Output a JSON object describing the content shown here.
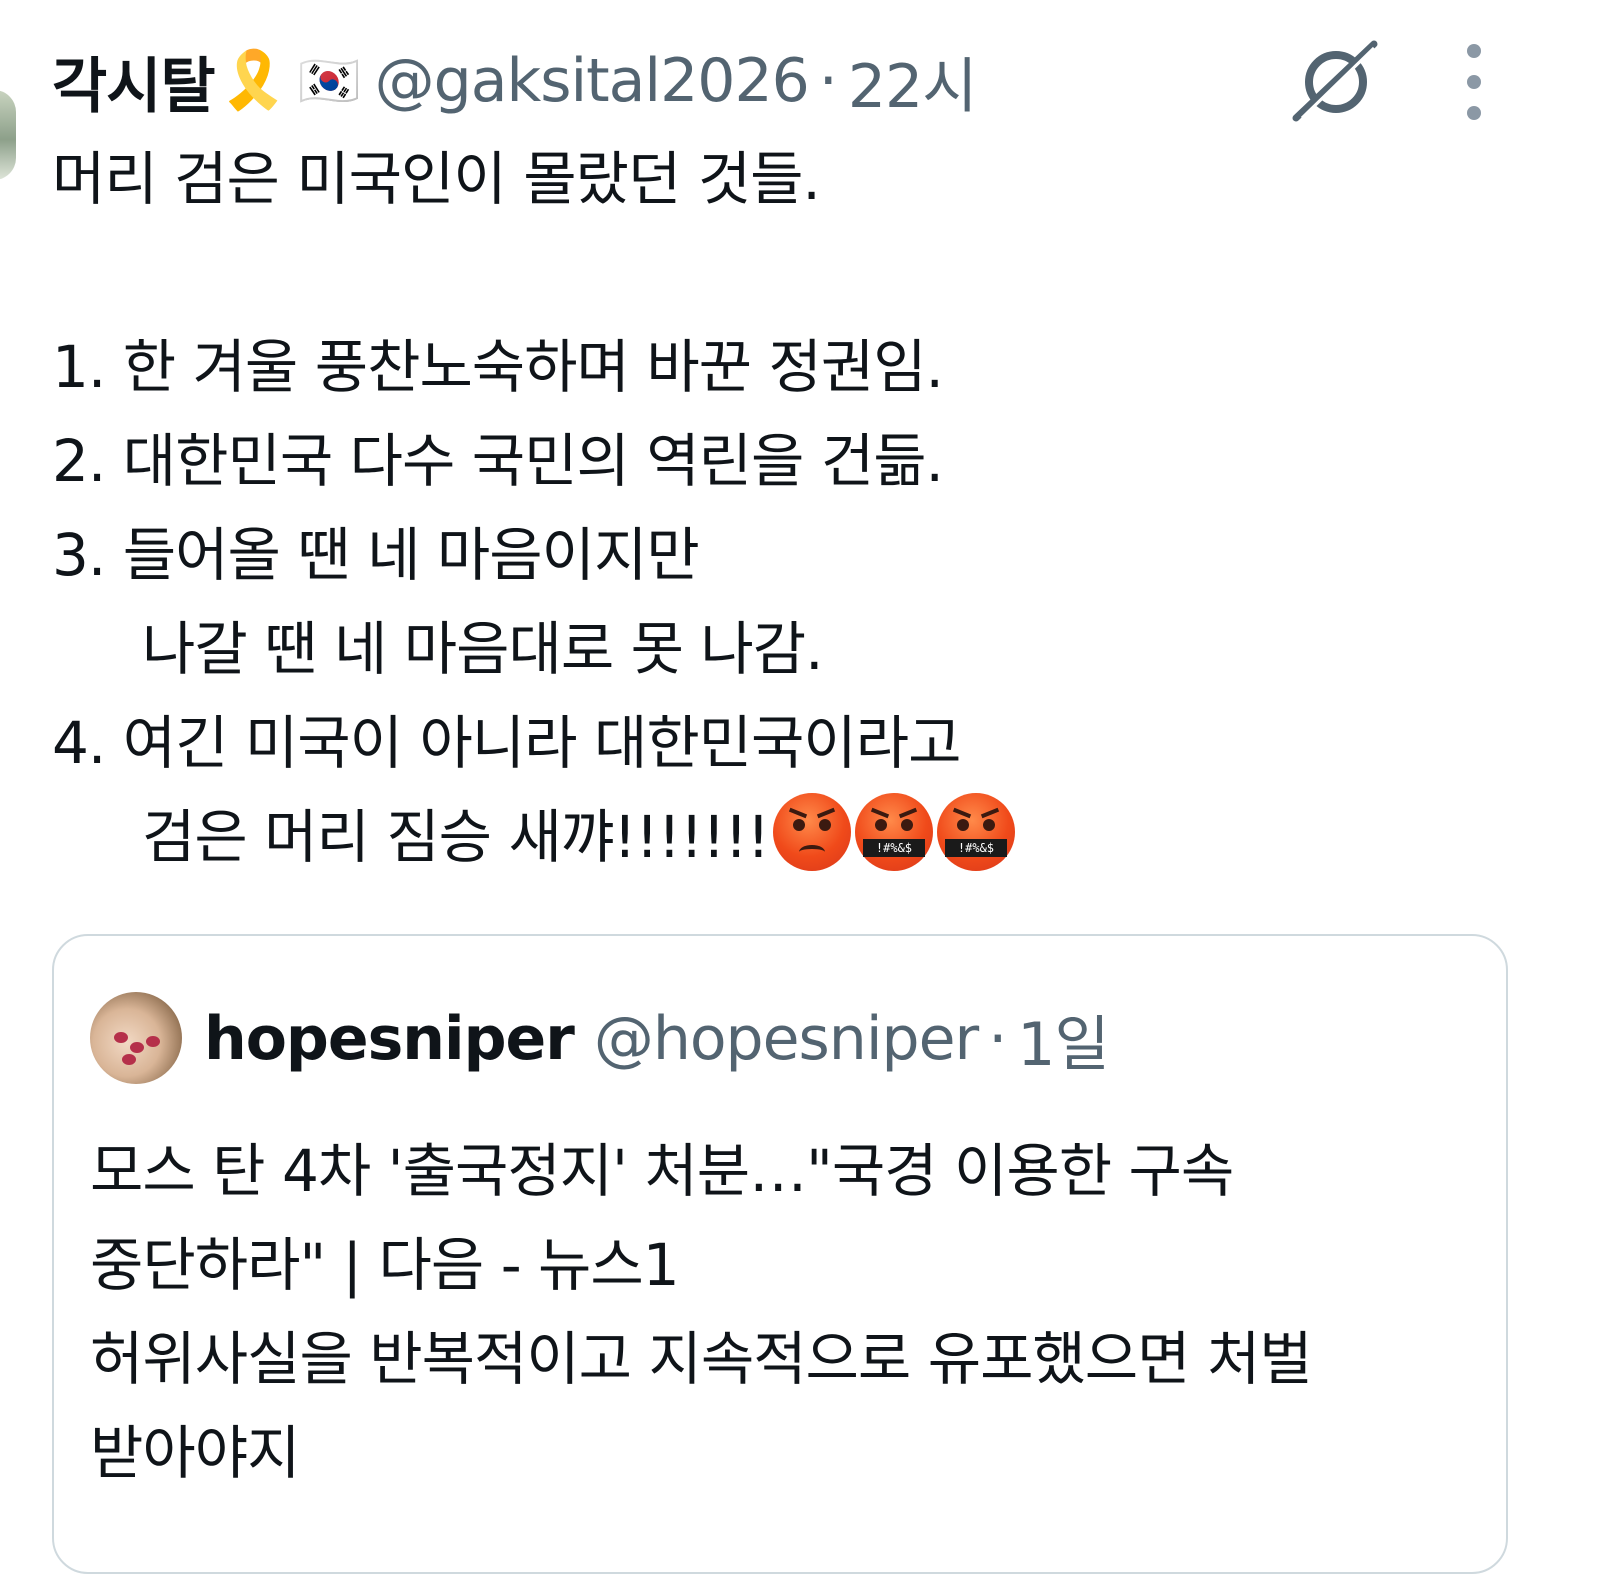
{
  "tweet": {
    "display_name": "각시탈",
    "badges": [
      "ribbon-emoji",
      "korea-flag-emoji"
    ],
    "ribbon": "🎗️",
    "flag": "🇰🇷",
    "handle": "@gaksital2026",
    "separator": "·",
    "time": "22시",
    "lines": [
      "머리 검은 미국인이 몰랐던 것들.",
      "",
      "1. 한 겨울 풍찬노숙하며 바꾼 정권임.",
      "2. 대한민국 다수 국민의 역린을 건듦.",
      "3. 들어올 땐 네 마음이지만",
      "나갈 땐 네 마음대로 못 나감.",
      "4. 여긴 미국이 아니라 대한민국이라고",
      "검은 머리 짐승 새꺄!!!!!!!"
    ],
    "emoji_faces": [
      "angry-face",
      "cursing-face",
      "cursing-face"
    ],
    "cursing_symbols": "!#%&$"
  },
  "quote": {
    "display_name": "hopesniper",
    "handle": "@hopesniper",
    "separator": "·",
    "time": "1일",
    "lines": [
      "모스 탄 4차 '출국정지' 처분…\"국경 이용한 구속",
      "중단하라\" | 다음 - 뉴스1",
      "허위사실을 반복적이고 지속적으로 유포했으면 처벌",
      "받아야지"
    ]
  },
  "colors": {
    "text_primary": "#0f1419",
    "text_secondary": "#536471",
    "border": "#cfd9de",
    "icon": "#8b98a5"
  },
  "icons": {
    "grok": "grok-icon",
    "more": "more-vertical-icon"
  }
}
